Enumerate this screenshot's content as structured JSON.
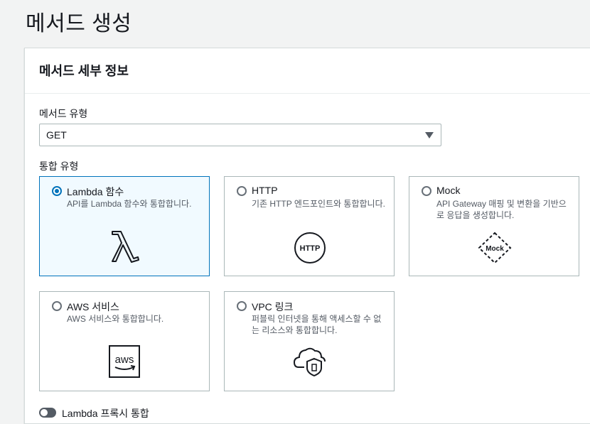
{
  "page": {
    "title": "메서드 생성"
  },
  "panel": {
    "title": "메서드 세부 정보"
  },
  "method_type": {
    "label": "메서드 유형",
    "value": "GET"
  },
  "integration": {
    "label": "통합 유형",
    "options": [
      {
        "title": "Lambda 함수",
        "desc": "API를 Lambda 함수와 통합합니다.",
        "selected": true,
        "icon": "lambda-icon"
      },
      {
        "title": "HTTP",
        "desc": "기존 HTTP 엔드포인트와 통합합니다.",
        "selected": false,
        "icon": "http-icon",
        "icon_text": "HTTP"
      },
      {
        "title": "Mock",
        "desc": "API Gateway 매핑 및 변환을 기반으로 응답을 생성합니다.",
        "selected": false,
        "icon": "mock-icon",
        "icon_text": "Mock"
      },
      {
        "title": "AWS 서비스",
        "desc": "AWS 서비스와 통합합니다.",
        "selected": false,
        "icon": "aws-icon",
        "icon_text": "aws"
      },
      {
        "title": "VPC 링크",
        "desc": "퍼블릭 인터넷을 통해 액세스할 수 없는 리소스와 통합합니다.",
        "selected": false,
        "icon": "cloud-shield-icon"
      }
    ]
  },
  "proxy_toggle": {
    "label": "Lambda 프록시 통합",
    "enabled": false
  },
  "colors": {
    "accent": "#0073bb",
    "selected_bg": "#f1faff",
    "border": "#aab7b8"
  }
}
